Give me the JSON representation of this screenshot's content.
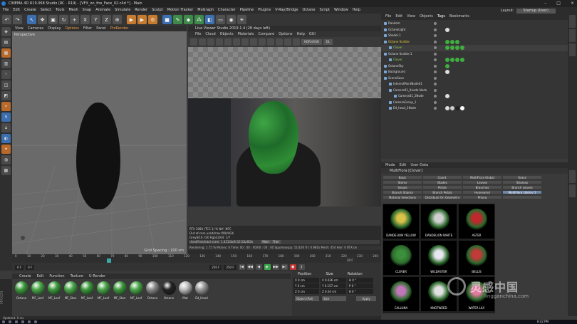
{
  "title": "CINEMA 4D R19.068 Studio (RC - R19) - [VFX_on_the_Face_02.c4d *] - Main",
  "menu": [
    "File",
    "Edit",
    "Create",
    "Select",
    "Tools",
    "Mesh",
    "Snap",
    "Animate",
    "Simulate",
    "Render",
    "Sculpt",
    "Motion Tracker",
    "MoGraph",
    "Character",
    "Pipeline",
    "Plugins",
    "V-Ray/Bridge",
    "Octane",
    "Script",
    "Window",
    "Help"
  ],
  "layout_label": "Layout:",
  "layout_value": "Startup (User)",
  "viewport": {
    "menu": [
      "View",
      "Cameras",
      "Display",
      "Options",
      "Filter",
      "Panel",
      "ProRender"
    ],
    "label": "Perspective",
    "grid_spacing": "Grid Spacing : 100 cm"
  },
  "timeline": {
    "ticks": [
      "0",
      "10",
      "20",
      "30",
      "40",
      "50",
      "60",
      "70",
      "80",
      "90",
      "100",
      "110",
      "120",
      "130",
      "140",
      "150",
      "160",
      "170",
      "180",
      "190",
      "200",
      "210",
      "220",
      "230",
      "240"
    ],
    "start_field": "0 F",
    "current_field": "0 F",
    "end_field": "250 F",
    "end_field2": "250 F",
    "frame_label": "20 F"
  },
  "materials": {
    "menu": [
      "Create",
      "Edit",
      "Function",
      "Texture",
      "U-Render"
    ],
    "items": [
      {
        "label": "Octane",
        "color": "#3c9a3c"
      },
      {
        "label": "MF_Leaf",
        "color": "#48a848"
      },
      {
        "label": "MF_Leaf",
        "color": "#3c9a3c"
      },
      {
        "label": "MF_Stan",
        "color": "#4aa84a"
      },
      {
        "label": "MF_Leaf",
        "color": "#3c9a3c"
      },
      {
        "label": "MF_Leaf",
        "color": "#49a449"
      },
      {
        "label": "MF_Stan",
        "color": "#3e9a3e"
      },
      {
        "label": "MF_Leaf",
        "color": "#4aa84a"
      },
      {
        "label": "Octane",
        "color": "#8a8a8a"
      },
      {
        "label": "Octane",
        "color": "#222222"
      },
      {
        "label": "Mat",
        "color": "#bdbdbd"
      },
      {
        "label": "Ed_Head",
        "color": "#9a9a9a"
      }
    ]
  },
  "coords": {
    "headers": [
      "Position",
      "Size",
      "Rotation"
    ],
    "rows": [
      [
        "X  0 cm",
        "X  0.036 cm",
        "H  0 °"
      ],
      [
        "Y  0 cm",
        "Y  0.157 cm",
        "P  0 °"
      ],
      [
        "Z  0 cm",
        "Z  0.04 cm",
        "B  0 °"
      ]
    ],
    "mode": "Object (Rel)",
    "size_mode": "Size",
    "apply": "Apply"
  },
  "status": "Updated: 0 ms",
  "image_viewer": {
    "title": "Live Viewer Studio 2019.1.4 (28 days left)",
    "menu": [
      "File",
      "Cloud",
      "Objects",
      "Materials",
      "Compare",
      "Options",
      "Help",
      "GUI"
    ],
    "hdr": "HDR/sRGB",
    "dl": "DL",
    "stats": [
      "RTX 2080 (TCC 1)               %             NA°            NFC",
      "Out-of-core used/max:0Kb/4Gb",
      "Grey8/16: 0/0                  Rgb32/64: 1/7",
      "Used/free/total vram: 1.431Gb/6.621Gb/8Gb",
      "Rendering: 1.75 %   Ms/sec: 0   Time: 00 : 00 : 00/00 : 00 : 00   Spp/maxspp: 51/100   Tri: 0.981k   Mesh: 454   Hair: 0   RTX:on"
    ],
    "main_btn": "Main",
    "tran_btn": "Tran"
  },
  "objects": {
    "menu": [
      "File",
      "Edit",
      "View",
      "Objects",
      "Tags",
      "Bookmarks"
    ],
    "rows": [
      {
        "name": "Random",
        "indent": 0,
        "style": "normal",
        "tags": []
      },
      {
        "name": "OctaneLight",
        "indent": 0,
        "style": "normal",
        "tags": [
          "#dddddd"
        ]
      },
      {
        "name": "Shader.1",
        "indent": 0,
        "style": "normal",
        "tags": []
      },
      {
        "name": "Octane Scatter",
        "indent": 0,
        "style": "yellow",
        "tags": [
          "#3fae3f",
          "#3fae3f",
          "#3fae3f"
        ]
      },
      {
        "name": "Clover",
        "indent": 1,
        "style": "green",
        "tags": [
          "#3fae3f",
          "#3fae3f",
          "#3fae3f",
          "#3fae3f"
        ]
      },
      {
        "name": "Octane Scatter.1",
        "indent": 0,
        "style": "normal",
        "tags": []
      },
      {
        "name": "Clover",
        "indent": 1,
        "style": "green",
        "tags": [
          "#3fae3f",
          "#3fae3f",
          "#3fae3f",
          "#3fae3f"
        ]
      },
      {
        "name": "OctaneSky",
        "indent": 0,
        "style": "normal",
        "tags": [
          "#3fae3f"
        ]
      },
      {
        "name": "Background",
        "indent": 0,
        "style": "normal",
        "tags": [
          "#dddddd"
        ]
      },
      {
        "name": "SceneSave",
        "indent": 0,
        "style": "normal",
        "tags": []
      },
      {
        "name": "InterestPointNode01",
        "indent": 1,
        "style": "normal",
        "tags": []
      },
      {
        "name": "Camera01_Xnode Node",
        "indent": 1,
        "style": "normal",
        "tags": []
      },
      {
        "name": "Camera01_2Node",
        "indent": 2,
        "style": "normal",
        "tags": [
          "#dddddd"
        ]
      },
      {
        "name": "CameraGroup_1",
        "indent": 1,
        "style": "normal",
        "tags": []
      },
      {
        "name": "Ed_head_2Node",
        "indent": 1,
        "style": "normal",
        "tags": [
          "#dddddd",
          "#cccccc",
          "#222222",
          "#ffffff"
        ]
      }
    ]
  },
  "attributes": {
    "menu": [
      "Mode",
      "Edit",
      "User Data"
    ],
    "title": "MultiFlora [Clover]",
    "tabs": [
      "Basic",
      "Coord.",
      "MultiFlora Global",
      "Grass",
      "Stems",
      "Blades",
      "Leaves",
      "Stigmas",
      "Sepals",
      "Petals",
      "Branches",
      "Branch Leaves",
      "Branch Stigma",
      "Branch Petals",
      "Hyperwind",
      "MultiFlora Library 1",
      "Material Selections",
      "Distribute On Geometry",
      "Phong",
      ""
    ],
    "active_tab": "MultiFlora Library 1",
    "plants": [
      {
        "label": "DANDELION YELLOW",
        "color": "#d8c24a"
      },
      {
        "label": "DANDELION WHITE",
        "color": "#cfcfcf"
      },
      {
        "label": "ASTER",
        "color": "#c0282e"
      },
      {
        "label": "CLOVER",
        "color": "#3c8f3c"
      },
      {
        "label": "WILDASTER",
        "color": "#e7e7ef"
      },
      {
        "label": "BELLIS",
        "color": "#c23a3a"
      },
      {
        "label": "CALLUNA",
        "color": "#c078b8"
      },
      {
        "label": "KNOTWEED",
        "color": "#e0e0e0"
      },
      {
        "label": "WATER LILY",
        "color": "#e07aa0"
      }
    ]
  },
  "taskbar_time": "8:42 PM",
  "watermark_cn": "灵感中国",
  "watermark_url": "lingganchina.com"
}
